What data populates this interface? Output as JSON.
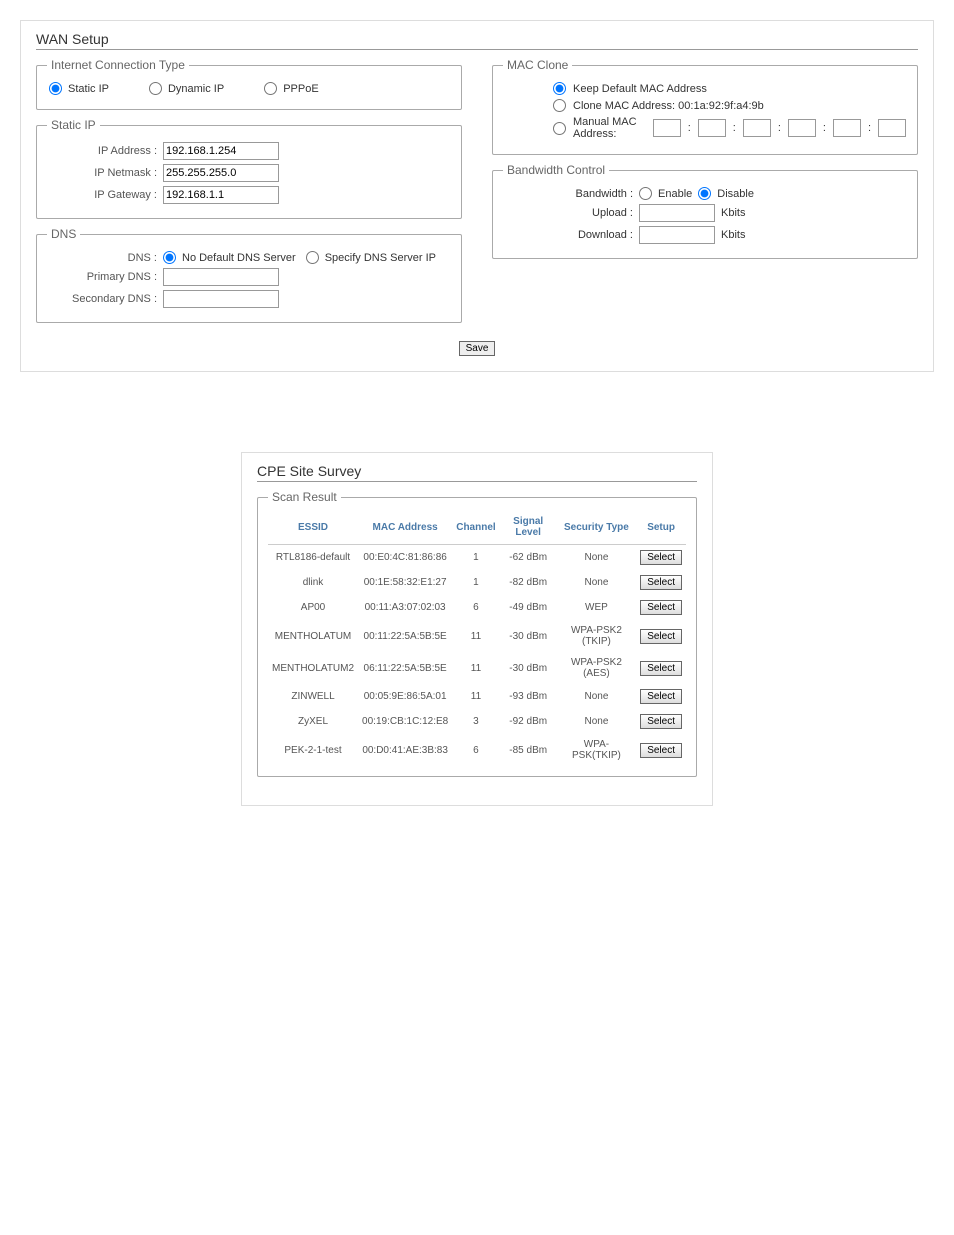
{
  "wan": {
    "title": "WAN Setup",
    "conn_type": {
      "legend": "Internet Connection Type",
      "static": "Static IP",
      "dynamic": "Dynamic IP",
      "pppoe": "PPPoE"
    },
    "static": {
      "legend": "Static IP",
      "ip_label": "IP Address :",
      "ip_value": "192.168.1.254",
      "netmask_label": "IP Netmask :",
      "netmask_value": "255.255.255.0",
      "gateway_label": "IP Gateway :",
      "gateway_value": "192.168.1.1"
    },
    "dns": {
      "legend": "DNS",
      "mode_label": "DNS :",
      "no_default": "No Default DNS Server",
      "specify": "Specify DNS Server IP",
      "primary_label": "Primary DNS :",
      "secondary_label": "Secondary DNS :"
    },
    "mac": {
      "legend": "MAC Clone",
      "keep": "Keep Default MAC Address",
      "clone": "Clone MAC Address: 00:1a:92:9f:a4:9b",
      "manual": "Manual MAC Address:"
    },
    "bw": {
      "legend": "Bandwidth Control",
      "label": "Bandwidth :",
      "enable": "Enable",
      "disable": "Disable",
      "upload_label": "Upload :",
      "download_label": "Download :",
      "unit": "Kbits"
    },
    "save": "Save"
  },
  "survey": {
    "title": "CPE Site Survey",
    "legend": "Scan Result",
    "headers": {
      "essid": "ESSID",
      "mac": "MAC Address",
      "channel": "Channel",
      "signal": "Signal Level",
      "security": "Security Type",
      "setup": "Setup"
    },
    "select_label": "Select",
    "rows": [
      {
        "essid": "RTL8186-default",
        "mac": "00:E0:4C:81:86:86",
        "ch": "1",
        "sig": "-62 dBm",
        "sec": "None"
      },
      {
        "essid": "dlink",
        "mac": "00:1E:58:32:E1:27",
        "ch": "1",
        "sig": "-82 dBm",
        "sec": "None"
      },
      {
        "essid": "AP00",
        "mac": "00:11:A3:07:02:03",
        "ch": "6",
        "sig": "-49 dBm",
        "sec": "WEP"
      },
      {
        "essid": "MENTHOLATUM",
        "mac": "00:11:22:5A:5B:5E",
        "ch": "11",
        "sig": "-30 dBm",
        "sec": "WPA-PSK2 (TKIP)"
      },
      {
        "essid": "MENTHOLATUM2",
        "mac": "06:11:22:5A:5B:5E",
        "ch": "11",
        "sig": "-30 dBm",
        "sec": "WPA-PSK2 (AES)"
      },
      {
        "essid": "ZINWELL",
        "mac": "00:05:9E:86:5A:01",
        "ch": "11",
        "sig": "-93 dBm",
        "sec": "None"
      },
      {
        "essid": "ZyXEL",
        "mac": "00:19:CB:1C:12:E8",
        "ch": "3",
        "sig": "-92 dBm",
        "sec": "None"
      },
      {
        "essid": "PEK-2-1-test",
        "mac": "00:D0:41:AE:3B:83",
        "ch": "6",
        "sig": "-85 dBm",
        "sec": "WPA-PSK(TKIP)"
      }
    ]
  }
}
